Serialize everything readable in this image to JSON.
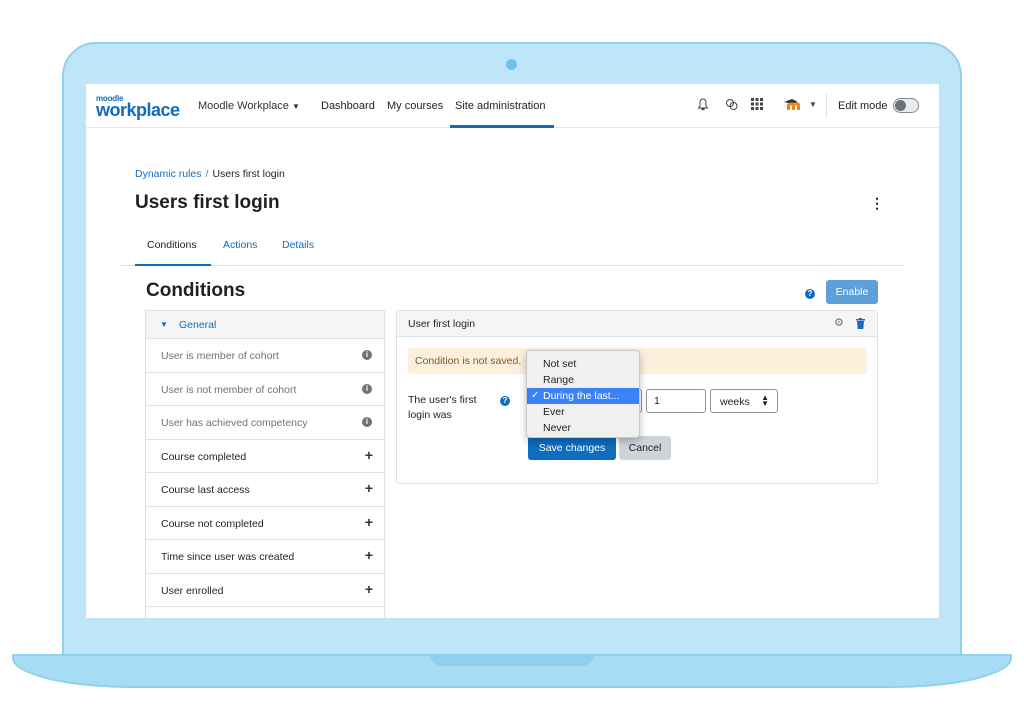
{
  "navbar": {
    "logo_small": "moodle",
    "logo_big": "workplace",
    "brand": "Moodle Workplace",
    "links": [
      "Dashboard",
      "My courses",
      "Site administration"
    ],
    "active_link": "Site administration",
    "edit_mode_label": "Edit mode",
    "edit_mode_on": false
  },
  "breadcrumb": {
    "parent": "Dynamic rules",
    "separator": "/",
    "current": "Users first login"
  },
  "page_title": "Users first login",
  "tabs": [
    {
      "label": "Conditions",
      "active": true
    },
    {
      "label": "Actions",
      "active": false
    },
    {
      "label": "Details",
      "active": false
    }
  ],
  "section": {
    "title": "Conditions",
    "enable_label": "Enable"
  },
  "condition_list": {
    "group_label": "General",
    "items": [
      {
        "label": "User is member of cohort",
        "icon": "info-icon",
        "enabled": false
      },
      {
        "label": "User is not member of cohort",
        "icon": "info-icon",
        "enabled": false
      },
      {
        "label": "User has achieved competency",
        "icon": "info-icon",
        "enabled": false
      },
      {
        "label": "Course completed",
        "icon": "plus-icon",
        "enabled": true
      },
      {
        "label": "Course last access",
        "icon": "plus-icon",
        "enabled": true
      },
      {
        "label": "Course not completed",
        "icon": "plus-icon",
        "enabled": true
      },
      {
        "label": "Time since user was created",
        "icon": "plus-icon",
        "enabled": true
      },
      {
        "label": "User enrolled",
        "icon": "plus-icon",
        "enabled": true
      }
    ]
  },
  "panel": {
    "title": "User first login",
    "alert": "Condition is not saved.",
    "field_label": "The user's first login was",
    "number_value": "1",
    "unit_value": "weeks",
    "save_label": "Save changes",
    "cancel_label": "Cancel"
  },
  "dropdown": {
    "options": [
      "Not set",
      "Range",
      "During the last...",
      "Ever",
      "Never"
    ],
    "selected": "During the last..."
  },
  "colors": {
    "brand_blue": "#0f6cbf",
    "alert_bg": "#fcefdc",
    "selected_bg": "#3b82f6"
  }
}
